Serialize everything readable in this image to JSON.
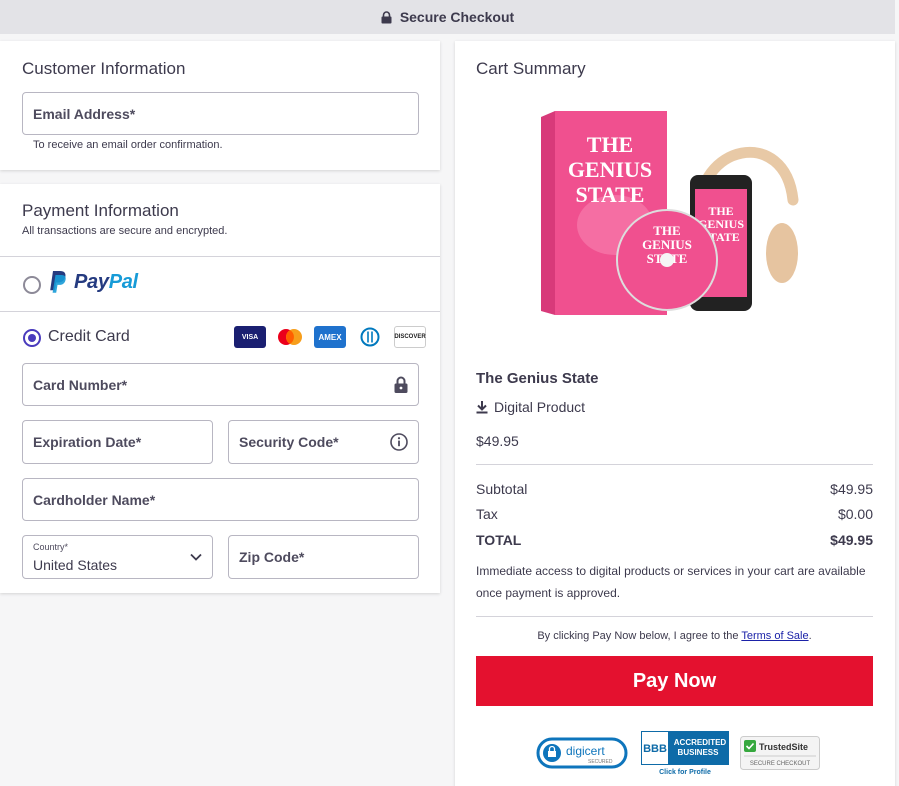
{
  "header": {
    "title": "Secure Checkout",
    "icon": "lock-icon"
  },
  "customer": {
    "title": "Customer Information",
    "email_label": "Email Address*",
    "email_hint": "To receive an email order confirmation."
  },
  "payment": {
    "title": "Payment Information",
    "subtitle": "All transactions are secure and encrypted.",
    "paypal": {
      "prefix": "Pay",
      "suffix": "Pal",
      "selected": false
    },
    "credit_card": {
      "label": "Credit Card",
      "selected": true
    },
    "card_brands": [
      "VISA",
      "mastercard",
      "AMEX",
      "Diners",
      "DISCOVER"
    ],
    "card_number_label": "Card Number*",
    "expiration_label": "Expiration Date*",
    "security_label": "Security Code*",
    "cardholder_label": "Cardholder Name*",
    "country_label": "Country*",
    "country_value": "United States",
    "zip_label": "Zip Code*"
  },
  "cart": {
    "title": "Cart Summary",
    "product_image_text": "THE GENIUS STATE",
    "product_name": "The Genius State",
    "product_type": "Digital Product",
    "product_price": "$49.95",
    "subtotal_label": "Subtotal",
    "subtotal_value": "$49.95",
    "tax_label": "Tax",
    "tax_value": "$0.00",
    "total_label": "TOTAL",
    "total_value": "$49.95",
    "note": "Immediate access to digital products or services in your cart are available once payment is approved.",
    "terms_prefix": "By clicking Pay Now below, I agree to the ",
    "terms_link": "Terms of Sale",
    "terms_suffix": ".",
    "pay_button": "Pay Now",
    "badges": {
      "digicert": "digicert",
      "digicert_sub": "SECURED",
      "bbb_line1": "ACCREDITED",
      "bbb_line2": "BUSINESS",
      "bbb_caption": "Click for Profile",
      "trusted": "TrustedSite",
      "trusted_sub": "SECURE CHECKOUT"
    }
  },
  "colors": {
    "accent": "#4a3bbd",
    "pay_button": "#e4112f",
    "paypal_dark": "#253b80",
    "paypal_light": "#179bd7"
  }
}
